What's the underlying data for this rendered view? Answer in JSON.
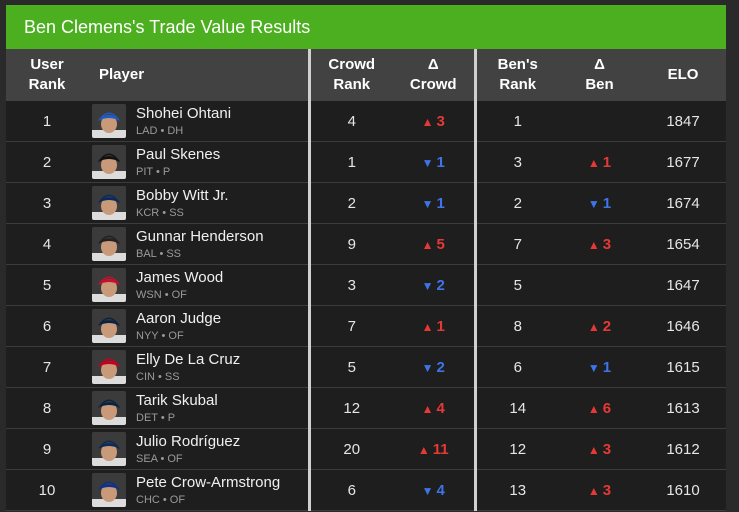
{
  "title": "Ben Clemens's Trade Value Results",
  "headers": {
    "user_rank": [
      "User",
      "Rank"
    ],
    "player": "Player",
    "crowd_rank": [
      "Crowd",
      "Rank"
    ],
    "delta_crowd": [
      "Δ",
      "Crowd"
    ],
    "bens_rank": [
      "Ben's",
      "Rank"
    ],
    "delta_ben": [
      "Δ",
      "Ben"
    ],
    "elo": "ELO"
  },
  "colors": {
    "up": "#e53935",
    "down": "#3e74e8",
    "title_bg": "#4caf1f"
  },
  "rows": [
    {
      "user_rank": "1",
      "name": "Shohei Ohtani",
      "meta": "LAD • DH",
      "crowd_rank": "4",
      "delta_crowd": {
        "dir": "up",
        "value": "3"
      },
      "bens_rank": "1",
      "delta_ben": null,
      "elo": "1847",
      "cap": "#1e5bc6"
    },
    {
      "user_rank": "2",
      "name": "Paul Skenes",
      "meta": "PIT • P",
      "crowd_rank": "1",
      "delta_crowd": {
        "dir": "down",
        "value": "1"
      },
      "bens_rank": "3",
      "delta_ben": {
        "dir": "up",
        "value": "1"
      },
      "elo": "1677",
      "cap": "#111111"
    },
    {
      "user_rank": "3",
      "name": "Bobby Witt Jr.",
      "meta": "KCR • SS",
      "crowd_rank": "2",
      "delta_crowd": {
        "dir": "down",
        "value": "1"
      },
      "bens_rank": "2",
      "delta_ben": {
        "dir": "down",
        "value": "1"
      },
      "elo": "1674",
      "cap": "#0b2a5c"
    },
    {
      "user_rank": "4",
      "name": "Gunnar Henderson",
      "meta": "BAL • SS",
      "crowd_rank": "9",
      "delta_crowd": {
        "dir": "up",
        "value": "5"
      },
      "bens_rank": "7",
      "delta_ben": {
        "dir": "up",
        "value": "3"
      },
      "elo": "1654",
      "cap": "#222222"
    },
    {
      "user_rank": "5",
      "name": "James Wood",
      "meta": "WSN • OF",
      "crowd_rank": "3",
      "delta_crowd": {
        "dir": "down",
        "value": "2"
      },
      "bens_rank": "5",
      "delta_ben": null,
      "elo": "1647",
      "cap": "#c8102e"
    },
    {
      "user_rank": "6",
      "name": "Aaron Judge",
      "meta": "NYY • OF",
      "crowd_rank": "7",
      "delta_crowd": {
        "dir": "up",
        "value": "1"
      },
      "bens_rank": "8",
      "delta_ben": {
        "dir": "up",
        "value": "2"
      },
      "elo": "1646",
      "cap": "#0c2340"
    },
    {
      "user_rank": "7",
      "name": "Elly De La Cruz",
      "meta": "CIN • SS",
      "crowd_rank": "5",
      "delta_crowd": {
        "dir": "down",
        "value": "2"
      },
      "bens_rank": "6",
      "delta_ben": {
        "dir": "down",
        "value": "1"
      },
      "elo": "1615",
      "cap": "#c6011f"
    },
    {
      "user_rank": "8",
      "name": "Tarik Skubal",
      "meta": "DET • P",
      "crowd_rank": "12",
      "delta_crowd": {
        "dir": "up",
        "value": "4"
      },
      "bens_rank": "14",
      "delta_ben": {
        "dir": "up",
        "value": "6"
      },
      "elo": "1613",
      "cap": "#0c2340"
    },
    {
      "user_rank": "9",
      "name": "Julio Rodríguez",
      "meta": "SEA • OF",
      "crowd_rank": "20",
      "delta_crowd": {
        "dir": "up",
        "value": "11"
      },
      "bens_rank": "12",
      "delta_ben": {
        "dir": "up",
        "value": "3"
      },
      "elo": "1612",
      "cap": "#0c2c56"
    },
    {
      "user_rank": "10",
      "name": "Pete Crow-Armstrong",
      "meta": "CHC • OF",
      "crowd_rank": "6",
      "delta_crowd": {
        "dir": "down",
        "value": "4"
      },
      "bens_rank": "13",
      "delta_ben": {
        "dir": "up",
        "value": "3"
      },
      "elo": "1610",
      "cap": "#0e3386"
    }
  ]
}
